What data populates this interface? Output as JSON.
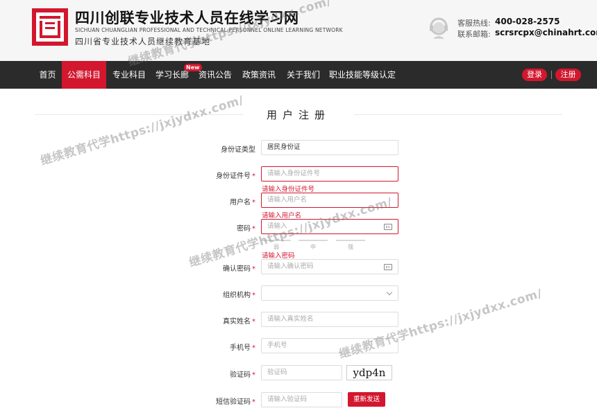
{
  "header": {
    "site_title": "四川创联专业技术人员在线学习网",
    "site_title_en": "SICHUAN CHUANGLIAN PROFESSIONAL AND TECHNICAL PERSONNEL ONLINE LEARNING NETWORK",
    "site_subtitle": "四川省专业技术人员继续教育基地",
    "hotline_label": "客服热线:",
    "hotline_value": "400-028-2575",
    "email_label": "联系邮箱:",
    "email_value": "scrsrcpx@chinahrt.com"
  },
  "nav": {
    "items": [
      "首页",
      "公需科目",
      "专业科目",
      "学习长廊",
      "资讯公告",
      "政策资讯",
      "关于我们",
      "职业技能等级认定"
    ],
    "new_badge": "New",
    "login": "登录",
    "register": "注册"
  },
  "form": {
    "title": "用户注册",
    "id_type": {
      "label": "身份证类型",
      "value": "居民身份证"
    },
    "id_number": {
      "label": "身份证件号",
      "placeholder": "请输入身份证件号",
      "error": "请输入身份证件号"
    },
    "username": {
      "label": "用户名",
      "placeholder": "请输入用户名",
      "error": "请输入用户名"
    },
    "password": {
      "label": "密码",
      "placeholder": "请输入",
      "error": "请输入密码",
      "strength": [
        "弱",
        "中",
        "强"
      ]
    },
    "confirm_password": {
      "label": "确认密码",
      "placeholder": "请输入确认密码"
    },
    "organization": {
      "label": "组织机构",
      "value": ""
    },
    "real_name": {
      "label": "真实姓名",
      "placeholder": "请输入真实姓名"
    },
    "phone": {
      "label": "手机号",
      "placeholder": "手机号"
    },
    "captcha": {
      "label": "验证码",
      "placeholder": "验证码",
      "image_text": "ydp4n"
    },
    "sms_code": {
      "label": "短信验证码",
      "placeholder": "请输入验证码",
      "button": "重新发送"
    }
  },
  "watermark": "继续教育代学https://jxjydxx.com/",
  "colors": {
    "brand_red": "#d2172e",
    "nav_bg": "#2b2b2b"
  }
}
